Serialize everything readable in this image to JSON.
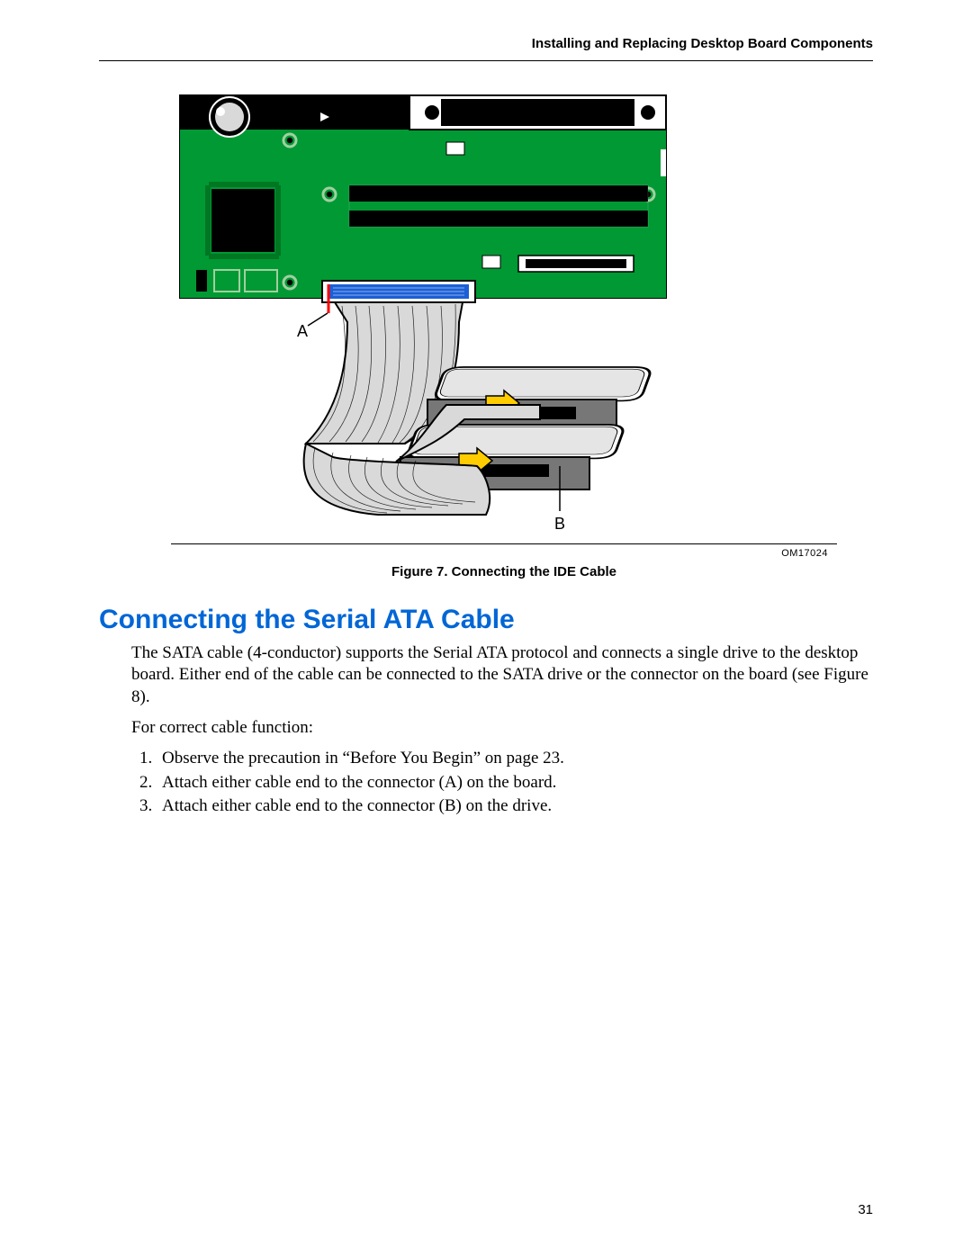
{
  "header": "Installing and Replacing Desktop Board Components",
  "figure": {
    "label_a": "A",
    "label_b": "B",
    "id": "OM17024",
    "caption": "Figure 7.  Connecting the IDE Cable"
  },
  "section_heading": "Connecting the Serial ATA Cable",
  "paragraph1": "The SATA cable (4-conductor) supports the Serial ATA protocol and connects a single drive to the desktop board.  Either end of the cable can be connected to the SATA drive or the connector on the board (see Figure 8).",
  "paragraph2": "For correct cable function:",
  "steps": [
    "Observe the precaution in “Before You Begin” on page 23.",
    "Attach either cable end to the connector (A) on the board.",
    "Attach either cable end to the connector (B) on the drive."
  ],
  "page_number": "31"
}
